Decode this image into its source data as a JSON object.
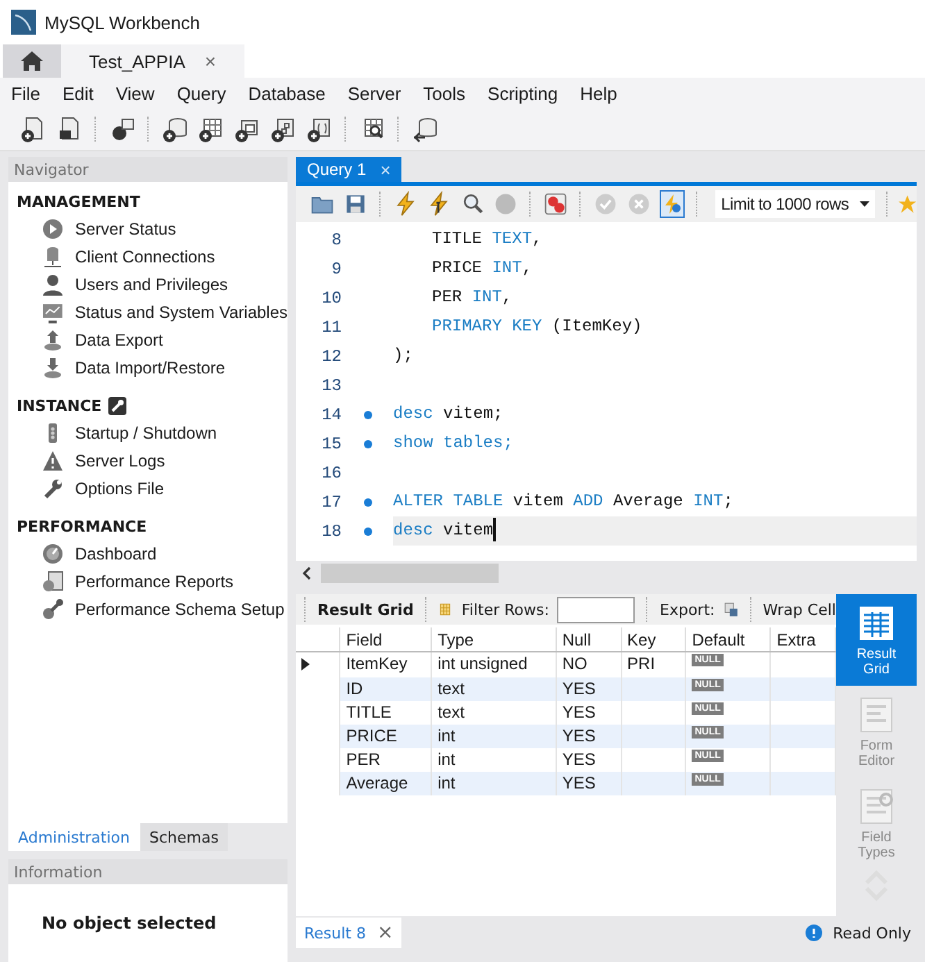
{
  "window": {
    "title": "MySQL Workbench"
  },
  "connection_tabs": [
    {
      "kind": "home",
      "selected": false
    },
    {
      "kind": "connection",
      "label": "Test_APPIA",
      "close": "×",
      "selected": true
    }
  ],
  "menu": [
    "File",
    "Edit",
    "View",
    "Query",
    "Database",
    "Server",
    "Tools",
    "Scripting",
    "Help"
  ],
  "navigator": {
    "title": "Navigator",
    "sections": [
      {
        "title": "MANAGEMENT",
        "items": [
          "Server Status",
          "Client Connections",
          "Users and Privileges",
          "Status and System Variables",
          "Data Export",
          "Data Import/Restore"
        ]
      },
      {
        "title": "INSTANCE",
        "items": [
          "Startup / Shutdown",
          "Server Logs",
          "Options File"
        ]
      },
      {
        "title": "PERFORMANCE",
        "items": [
          "Dashboard",
          "Performance Reports",
          "Performance Schema Setup"
        ]
      }
    ],
    "tabs": [
      {
        "label": "Administration",
        "selected": true
      },
      {
        "label": "Schemas",
        "selected": false
      }
    ]
  },
  "information": {
    "title": "Information",
    "message": "No object selected"
  },
  "query_tabs": [
    {
      "label": "Query 1",
      "close": "×",
      "selected": true
    }
  ],
  "editor_toolbar": {
    "limit": "Limit to 1000 rows",
    "toggle_on": true
  },
  "editor": {
    "lines": [
      {
        "number": "8",
        "marker": false,
        "indented": true,
        "current": false,
        "tokens": [
          {
            "text": "TITLE",
            "kind": "plain"
          },
          {
            "text": "TEXT",
            "kind": "keyword"
          },
          {
            "text": ",",
            "kind": "punct"
          }
        ]
      },
      {
        "number": "9",
        "marker": false,
        "indented": true,
        "current": false,
        "tokens": [
          {
            "text": "PRICE",
            "kind": "plain"
          },
          {
            "text": "INT",
            "kind": "keyword"
          },
          {
            "text": ",",
            "kind": "punct"
          }
        ]
      },
      {
        "number": "10",
        "marker": false,
        "indented": true,
        "current": false,
        "tokens": [
          {
            "text": "PER",
            "kind": "plain"
          },
          {
            "text": "INT",
            "kind": "keyword"
          },
          {
            "text": ",",
            "kind": "punct"
          }
        ]
      },
      {
        "number": "11",
        "marker": false,
        "indented": true,
        "current": false,
        "tokens": [
          {
            "text": "PRIMARY KEY",
            "kind": "keyword"
          },
          {
            "text": "(ItemKey)",
            "kind": "plain"
          }
        ]
      },
      {
        "number": "12",
        "marker": false,
        "indented": false,
        "current": false,
        "tokens": [
          {
            "text": ");",
            "kind": "plain"
          }
        ]
      },
      {
        "number": "13",
        "marker": false
      },
      {
        "number": "14",
        "marker": true,
        "indented": false,
        "current": false,
        "tokens": [
          {
            "text": "desc",
            "kind": "keyword"
          },
          {
            "text": "vitem;",
            "kind": "plain"
          }
        ]
      },
      {
        "number": "15",
        "marker": true,
        "indented": false,
        "current": false,
        "tokens": [
          {
            "text": "show tables;",
            "kind": "keyword"
          }
        ]
      },
      {
        "number": "16",
        "marker": false
      },
      {
        "number": "17",
        "marker": true,
        "indented": false,
        "current": false,
        "tokens": [
          {
            "text": "ALTER TABLE",
            "kind": "keyword"
          },
          {
            "text": "vitem",
            "kind": "plain"
          },
          {
            "text": "ADD",
            "kind": "keyword"
          },
          {
            "text": "Average",
            "kind": "plain"
          },
          {
            "text": "INT",
            "kind": "keyword"
          },
          {
            "text": ";",
            "kind": "punct"
          }
        ]
      },
      {
        "number": "18",
        "marker": true,
        "indented": false,
        "current": true,
        "tokens": [
          {
            "text": "desc",
            "kind": "keyword"
          },
          {
            "text": "vitem",
            "kind": "plain"
          }
        ]
      }
    ]
  },
  "result_toolbar": {
    "view": "Result Grid",
    "filter_label": "Filter Rows:",
    "export_label": "Export:",
    "wrap_label": "Wrap Cell"
  },
  "table": {
    "columns": [
      "Field",
      "Type",
      "Null",
      "Key",
      "Default",
      "Extra"
    ],
    "rows": [
      {
        "current": true,
        "cells": [
          "ItemKey",
          "int unsigned",
          "NO",
          "PRI",
          "NULL",
          ""
        ]
      },
      {
        "current": false,
        "cells": [
          "ID",
          "text",
          "YES",
          "",
          "NULL",
          ""
        ]
      },
      {
        "current": false,
        "cells": [
          "TITLE",
          "text",
          "YES",
          "",
          "NULL",
          ""
        ]
      },
      {
        "current": false,
        "cells": [
          "PRICE",
          "int",
          "YES",
          "",
          "NULL",
          ""
        ]
      },
      {
        "current": false,
        "cells": [
          "PER",
          "int",
          "YES",
          "",
          "NULL",
          ""
        ]
      },
      {
        "current": false,
        "cells": [
          "Average",
          "int",
          "YES",
          "",
          "NULL",
          ""
        ]
      }
    ]
  },
  "result_views": [
    {
      "label": "Result Grid",
      "selected": true
    },
    {
      "label": "Form Editor",
      "selected": false
    },
    {
      "label": "Field Types",
      "selected": false
    }
  ],
  "result_tabs": [
    {
      "label": "Result 8",
      "close": "×",
      "selected": true
    }
  ],
  "status": "Read Only"
}
